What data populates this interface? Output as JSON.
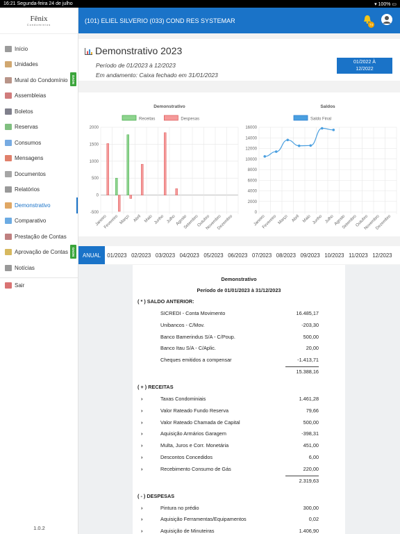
{
  "status": {
    "time": "16:21",
    "date": "Segunda-feira 24 de julho",
    "battery": "100%"
  },
  "logo": {
    "name": "Fênix",
    "sub": "Condomínios"
  },
  "sidebar": {
    "items": [
      {
        "label": "Início",
        "icon": "home-icon"
      },
      {
        "label": "Unidades",
        "icon": "user-icon"
      },
      {
        "label": "Mural do Condomínio",
        "icon": "board-icon",
        "badge": "NOVO"
      },
      {
        "label": "Assembleias",
        "icon": "people-icon"
      },
      {
        "label": "Boletos",
        "icon": "barcode-icon"
      },
      {
        "label": "Reservas",
        "icon": "calendar-icon"
      },
      {
        "label": "Consumos",
        "icon": "meter-icon"
      },
      {
        "label": "Mensagens",
        "icon": "chat-icon"
      },
      {
        "label": "Documentos",
        "icon": "document-icon"
      },
      {
        "label": "Relatórios",
        "icon": "report-icon"
      },
      {
        "label": "Demonstrativo",
        "icon": "chart-icon"
      },
      {
        "label": "Comparativo",
        "icon": "compare-icon"
      },
      {
        "label": "Prestação de Contas",
        "icon": "accounts-icon"
      },
      {
        "label": "Aprovação de Contas",
        "icon": "approval-icon",
        "badge": "NOVO"
      },
      {
        "label": "Notícias",
        "icon": "news-icon"
      },
      {
        "label": "Sair",
        "icon": "exit-icon"
      }
    ],
    "version": "1.0.2"
  },
  "header": {
    "title": "(101) ELIEL SILVERIO  (033) COND RES SYSTEMAR",
    "badge_count": "74"
  },
  "page": {
    "title": "Demonstrativo 2023",
    "period": "Período de 01/2023 à 12/2023",
    "status": "Em andamento: Caixa fechado em 31/01/2023",
    "date_button_line1": "01/2022 À",
    "date_button_line2": "12/2022"
  },
  "chart_data": [
    {
      "type": "bar",
      "title": "Demonstrativo",
      "categories": [
        "Janeiro",
        "Fevereiro",
        "Março",
        "Abril",
        "Maio",
        "Junho",
        "Julho",
        "Agosto",
        "Setembro",
        "Outubro",
        "Novembro",
        "Dezembro"
      ],
      "series": [
        {
          "name": "Receitas",
          "color": "#8fd48f",
          "values": [
            0,
            500,
            1780,
            0,
            0,
            0,
            0,
            0,
            0,
            0,
            0,
            0
          ]
        },
        {
          "name": "Despesas",
          "color": "#f59a9a",
          "values": [
            1520,
            -480,
            -100,
            910,
            0,
            1840,
            190,
            0,
            0,
            0,
            0,
            0
          ]
        }
      ],
      "ylim": [
        -500,
        2000
      ],
      "yticks": [
        -500,
        0,
        500,
        1000,
        1500,
        2000
      ],
      "legend": "top"
    },
    {
      "type": "line",
      "title": "Saldos",
      "categories": [
        "Janeiro",
        "Fevereiro",
        "Março",
        "Abril",
        "Maio",
        "Junho",
        "Julho",
        "Agosto",
        "Setembro",
        "Outubro",
        "Novembro",
        "Dezembro"
      ],
      "series": [
        {
          "name": "Saldo Final",
          "color": "#4a9fe0",
          "values": [
            10500,
            11400,
            13600,
            12500,
            12550,
            15800,
            15500
          ]
        }
      ],
      "ylim": [
        0,
        16000
      ],
      "yticks": [
        0,
        2000,
        4000,
        6000,
        8000,
        10000,
        12000,
        14000,
        16000
      ],
      "legend": "top"
    }
  ],
  "tabs": [
    "ANUAL",
    "01/2023",
    "02/2023",
    "03/2023",
    "04/2023",
    "05/2023",
    "06/2023",
    "07/2023",
    "08/2023",
    "09/2023",
    "10/2023",
    "11/2023",
    "12/2023"
  ],
  "report": {
    "title": "Demonstrativo",
    "period": "Período de 01/01/2023 à 31/12/2023",
    "saldo_label": "( * ) SALDO ANTERIOR:",
    "saldo": [
      [
        "SICREDI - Conta Movimento",
        "16.485,17"
      ],
      [
        "Unibancos - C/Mov.",
        "-203,30"
      ],
      [
        "Banco Bamerindus S/A - C/Poup.",
        "500,00"
      ],
      [
        "Banco Itau S/A - C/Aplic.",
        "20,00"
      ],
      [
        "Cheques emitidos a compensar",
        "-1.413,71"
      ]
    ],
    "saldo_total": "15.388,16",
    "receitas_label": "( + ) RECEITAS",
    "receitas": [
      [
        "Taxas Condominiais",
        "1.461,28"
      ],
      [
        "Valor Rateado Fundo Reserva",
        "79,66"
      ],
      [
        "Valor Rateado Chamada de Capital",
        "500,00"
      ],
      [
        "Aquisição Armários Garagem",
        "-398,31"
      ],
      [
        "Multa, Juros e Corr. Monetária",
        "451,00"
      ],
      [
        "Descontos Concedidos",
        "6,00"
      ],
      [
        "Recebimento Consumo de Gás",
        "220,00"
      ]
    ],
    "receitas_total": "2.319,63",
    "despesas_label": "( - ) DESPESAS",
    "despesas": [
      [
        "Pintura no prédio",
        "300,00"
      ],
      [
        "Aquisição Ferramentas/Equipamentos",
        "0,02"
      ],
      [
        "Aquisição de Minuteiras",
        "1.406,90"
      ]
    ]
  }
}
